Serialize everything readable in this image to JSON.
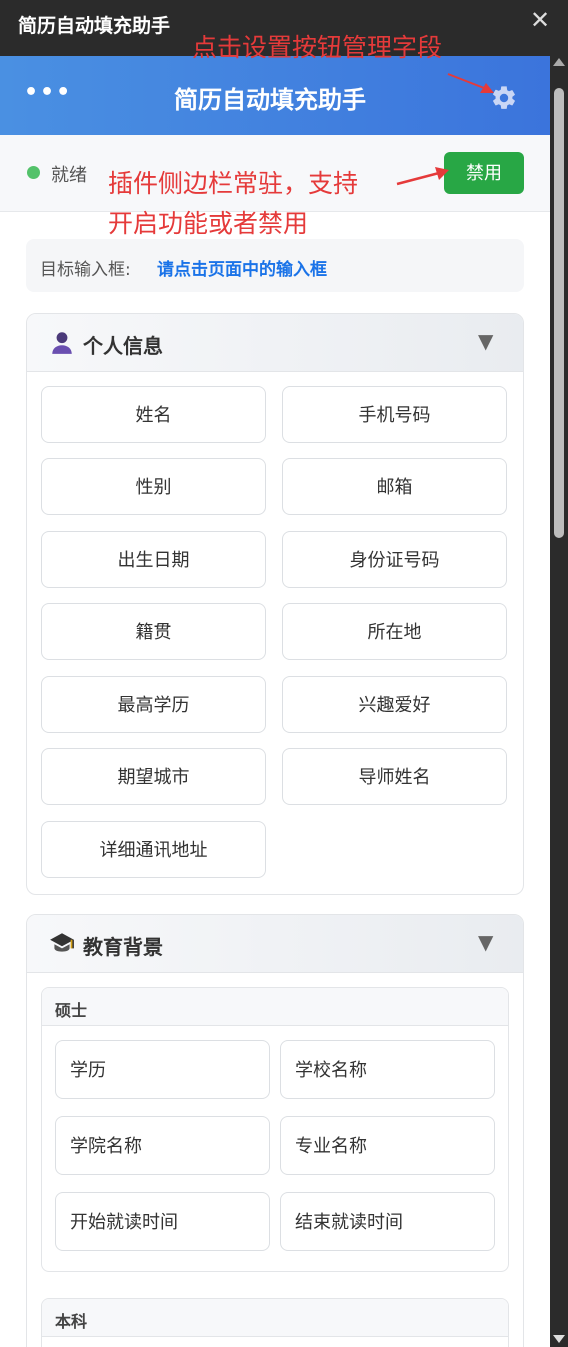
{
  "window": {
    "title": "简历自动填充助手",
    "close_glyph": "✕"
  },
  "header": {
    "menu_glyph": "•••",
    "title": "简历自动填充助手"
  },
  "status": {
    "text": "就绪",
    "disable_label": "禁用",
    "dot_color": "#53c26a"
  },
  "target": {
    "label": "目标输入框:",
    "value": "请点击页面中的输入框"
  },
  "personal": {
    "title": "个人信息",
    "toggle": "▼",
    "fields": [
      "姓名",
      "手机号码",
      "性别",
      "邮箱",
      "出生日期",
      "身份证号码",
      "籍贯",
      "所在地",
      "最高学历",
      "兴趣爱好",
      "期望城市",
      "导师姓名",
      "详细通讯地址"
    ]
  },
  "education": {
    "title": "教育背景",
    "toggle": "▼",
    "masters": {
      "title": "硕士",
      "fields": [
        "学历",
        "学校名称",
        "学院名称",
        "专业名称",
        "开始就读时间",
        "结束就读时间"
      ]
    },
    "bachelor": {
      "title": "本科"
    }
  },
  "annotations": {
    "gear_note": "点击设置按钮管理字段",
    "sidebar_note_line1": "插件侧边栏常驻，支持",
    "sidebar_note_line2": "开启功能或者禁用"
  },
  "colors": {
    "accent": "#3b74dc",
    "disable": "#28a745",
    "annotation": "#e53a3a",
    "link": "#1a73e8"
  }
}
